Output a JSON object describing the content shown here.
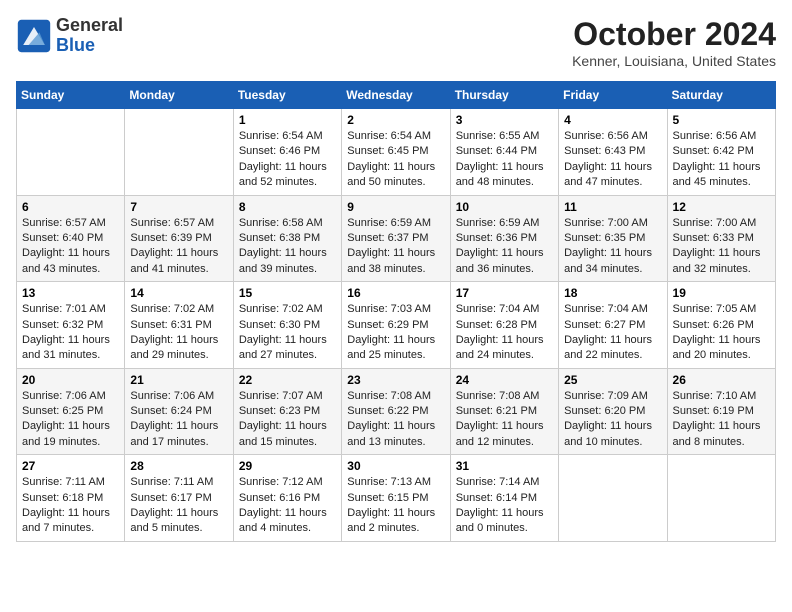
{
  "header": {
    "logo": {
      "general": "General",
      "blue": "Blue"
    },
    "month": "October 2024",
    "location": "Kenner, Louisiana, United States"
  },
  "weekdays": [
    "Sunday",
    "Monday",
    "Tuesday",
    "Wednesday",
    "Thursday",
    "Friday",
    "Saturday"
  ],
  "weeks": [
    [
      null,
      null,
      {
        "day": "1",
        "sunrise": "Sunrise: 6:54 AM",
        "sunset": "Sunset: 6:46 PM",
        "daylight": "Daylight: 11 hours and 52 minutes."
      },
      {
        "day": "2",
        "sunrise": "Sunrise: 6:54 AM",
        "sunset": "Sunset: 6:45 PM",
        "daylight": "Daylight: 11 hours and 50 minutes."
      },
      {
        "day": "3",
        "sunrise": "Sunrise: 6:55 AM",
        "sunset": "Sunset: 6:44 PM",
        "daylight": "Daylight: 11 hours and 48 minutes."
      },
      {
        "day": "4",
        "sunrise": "Sunrise: 6:56 AM",
        "sunset": "Sunset: 6:43 PM",
        "daylight": "Daylight: 11 hours and 47 minutes."
      },
      {
        "day": "5",
        "sunrise": "Sunrise: 6:56 AM",
        "sunset": "Sunset: 6:42 PM",
        "daylight": "Daylight: 11 hours and 45 minutes."
      }
    ],
    [
      {
        "day": "6",
        "sunrise": "Sunrise: 6:57 AM",
        "sunset": "Sunset: 6:40 PM",
        "daylight": "Daylight: 11 hours and 43 minutes."
      },
      {
        "day": "7",
        "sunrise": "Sunrise: 6:57 AM",
        "sunset": "Sunset: 6:39 PM",
        "daylight": "Daylight: 11 hours and 41 minutes."
      },
      {
        "day": "8",
        "sunrise": "Sunrise: 6:58 AM",
        "sunset": "Sunset: 6:38 PM",
        "daylight": "Daylight: 11 hours and 39 minutes."
      },
      {
        "day": "9",
        "sunrise": "Sunrise: 6:59 AM",
        "sunset": "Sunset: 6:37 PM",
        "daylight": "Daylight: 11 hours and 38 minutes."
      },
      {
        "day": "10",
        "sunrise": "Sunrise: 6:59 AM",
        "sunset": "Sunset: 6:36 PM",
        "daylight": "Daylight: 11 hours and 36 minutes."
      },
      {
        "day": "11",
        "sunrise": "Sunrise: 7:00 AM",
        "sunset": "Sunset: 6:35 PM",
        "daylight": "Daylight: 11 hours and 34 minutes."
      },
      {
        "day": "12",
        "sunrise": "Sunrise: 7:00 AM",
        "sunset": "Sunset: 6:33 PM",
        "daylight": "Daylight: 11 hours and 32 minutes."
      }
    ],
    [
      {
        "day": "13",
        "sunrise": "Sunrise: 7:01 AM",
        "sunset": "Sunset: 6:32 PM",
        "daylight": "Daylight: 11 hours and 31 minutes."
      },
      {
        "day": "14",
        "sunrise": "Sunrise: 7:02 AM",
        "sunset": "Sunset: 6:31 PM",
        "daylight": "Daylight: 11 hours and 29 minutes."
      },
      {
        "day": "15",
        "sunrise": "Sunrise: 7:02 AM",
        "sunset": "Sunset: 6:30 PM",
        "daylight": "Daylight: 11 hours and 27 minutes."
      },
      {
        "day": "16",
        "sunrise": "Sunrise: 7:03 AM",
        "sunset": "Sunset: 6:29 PM",
        "daylight": "Daylight: 11 hours and 25 minutes."
      },
      {
        "day": "17",
        "sunrise": "Sunrise: 7:04 AM",
        "sunset": "Sunset: 6:28 PM",
        "daylight": "Daylight: 11 hours and 24 minutes."
      },
      {
        "day": "18",
        "sunrise": "Sunrise: 7:04 AM",
        "sunset": "Sunset: 6:27 PM",
        "daylight": "Daylight: 11 hours and 22 minutes."
      },
      {
        "day": "19",
        "sunrise": "Sunrise: 7:05 AM",
        "sunset": "Sunset: 6:26 PM",
        "daylight": "Daylight: 11 hours and 20 minutes."
      }
    ],
    [
      {
        "day": "20",
        "sunrise": "Sunrise: 7:06 AM",
        "sunset": "Sunset: 6:25 PM",
        "daylight": "Daylight: 11 hours and 19 minutes."
      },
      {
        "day": "21",
        "sunrise": "Sunrise: 7:06 AM",
        "sunset": "Sunset: 6:24 PM",
        "daylight": "Daylight: 11 hours and 17 minutes."
      },
      {
        "day": "22",
        "sunrise": "Sunrise: 7:07 AM",
        "sunset": "Sunset: 6:23 PM",
        "daylight": "Daylight: 11 hours and 15 minutes."
      },
      {
        "day": "23",
        "sunrise": "Sunrise: 7:08 AM",
        "sunset": "Sunset: 6:22 PM",
        "daylight": "Daylight: 11 hours and 13 minutes."
      },
      {
        "day": "24",
        "sunrise": "Sunrise: 7:08 AM",
        "sunset": "Sunset: 6:21 PM",
        "daylight": "Daylight: 11 hours and 12 minutes."
      },
      {
        "day": "25",
        "sunrise": "Sunrise: 7:09 AM",
        "sunset": "Sunset: 6:20 PM",
        "daylight": "Daylight: 11 hours and 10 minutes."
      },
      {
        "day": "26",
        "sunrise": "Sunrise: 7:10 AM",
        "sunset": "Sunset: 6:19 PM",
        "daylight": "Daylight: 11 hours and 8 minutes."
      }
    ],
    [
      {
        "day": "27",
        "sunrise": "Sunrise: 7:11 AM",
        "sunset": "Sunset: 6:18 PM",
        "daylight": "Daylight: 11 hours and 7 minutes."
      },
      {
        "day": "28",
        "sunrise": "Sunrise: 7:11 AM",
        "sunset": "Sunset: 6:17 PM",
        "daylight": "Daylight: 11 hours and 5 minutes."
      },
      {
        "day": "29",
        "sunrise": "Sunrise: 7:12 AM",
        "sunset": "Sunset: 6:16 PM",
        "daylight": "Daylight: 11 hours and 4 minutes."
      },
      {
        "day": "30",
        "sunrise": "Sunrise: 7:13 AM",
        "sunset": "Sunset: 6:15 PM",
        "daylight": "Daylight: 11 hours and 2 minutes."
      },
      {
        "day": "31",
        "sunrise": "Sunrise: 7:14 AM",
        "sunset": "Sunset: 6:14 PM",
        "daylight": "Daylight: 11 hours and 0 minutes."
      },
      null,
      null
    ]
  ]
}
